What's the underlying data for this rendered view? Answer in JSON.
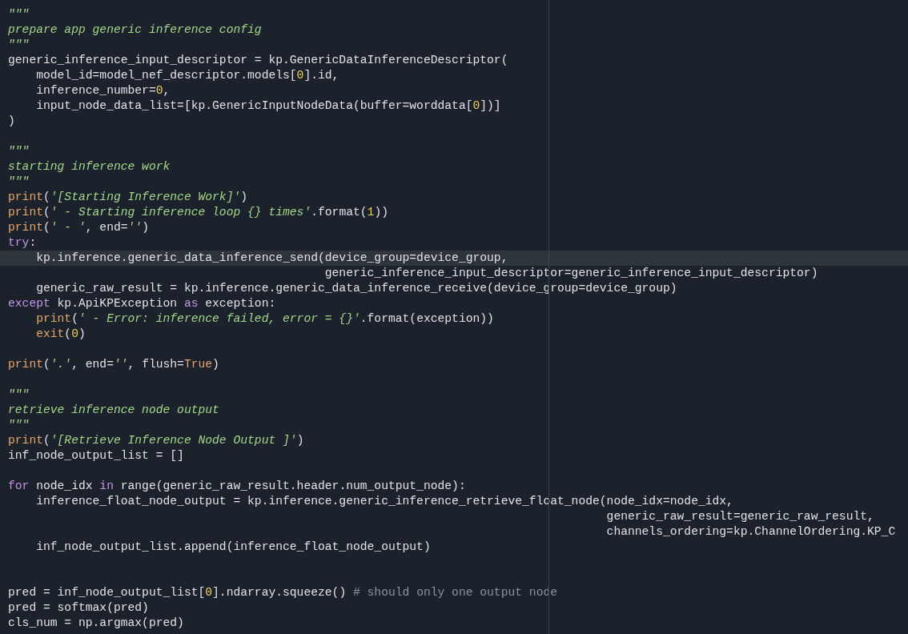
{
  "editor": {
    "lines": [
      {
        "selected": false,
        "tokens": [
          {
            "kind": "str",
            "text": "\"\"\""
          }
        ]
      },
      {
        "selected": false,
        "tokens": [
          {
            "kind": "str",
            "text": "prepare app generic inference config"
          }
        ]
      },
      {
        "selected": false,
        "tokens": [
          {
            "kind": "str",
            "text": "\"\"\""
          }
        ]
      },
      {
        "selected": false,
        "tokens": [
          {
            "kind": "plain",
            "text": "generic_inference_input_descriptor = kp.GenericDataInferenceDescriptor("
          }
        ]
      },
      {
        "selected": false,
        "tokens": [
          {
            "kind": "plain",
            "text": "    model_id=model_nef_descriptor.models["
          },
          {
            "kind": "num",
            "text": "0"
          },
          {
            "kind": "plain",
            "text": "].id,"
          }
        ]
      },
      {
        "selected": false,
        "tokens": [
          {
            "kind": "plain",
            "text": "    inference_number="
          },
          {
            "kind": "num",
            "text": "0"
          },
          {
            "kind": "plain",
            "text": ","
          }
        ]
      },
      {
        "selected": false,
        "tokens": [
          {
            "kind": "plain",
            "text": "    input_node_data_list=[kp.GenericInputNodeData(buffer=worddata["
          },
          {
            "kind": "num",
            "text": "0"
          },
          {
            "kind": "plain",
            "text": "])]"
          }
        ]
      },
      {
        "selected": false,
        "tokens": [
          {
            "kind": "plain",
            "text": ")"
          }
        ]
      },
      {
        "selected": false
      },
      {
        "selected": false,
        "tokens": [
          {
            "kind": "str",
            "text": "\"\"\""
          }
        ]
      },
      {
        "selected": false,
        "tokens": [
          {
            "kind": "str",
            "text": "starting inference work"
          }
        ]
      },
      {
        "selected": false,
        "tokens": [
          {
            "kind": "str",
            "text": "\"\"\""
          }
        ]
      },
      {
        "selected": false,
        "tokens": [
          {
            "kind": "fn",
            "text": "print"
          },
          {
            "kind": "plain",
            "text": "("
          },
          {
            "kind": "str",
            "text": "'[Starting Inference Work]'"
          },
          {
            "kind": "plain",
            "text": ")"
          }
        ]
      },
      {
        "selected": false,
        "tokens": [
          {
            "kind": "fn",
            "text": "print"
          },
          {
            "kind": "plain",
            "text": "("
          },
          {
            "kind": "str",
            "text": "' - Starting inference loop {} times'"
          },
          {
            "kind": "plain",
            "text": ".format("
          },
          {
            "kind": "num",
            "text": "1"
          },
          {
            "kind": "plain",
            "text": "))"
          }
        ]
      },
      {
        "selected": false,
        "tokens": [
          {
            "kind": "fn",
            "text": "print"
          },
          {
            "kind": "plain",
            "text": "("
          },
          {
            "kind": "str",
            "text": "' - '"
          },
          {
            "kind": "plain",
            "text": ", end="
          },
          {
            "kind": "str",
            "text": "''"
          },
          {
            "kind": "plain",
            "text": ")"
          }
        ]
      },
      {
        "selected": false,
        "tokens": [
          {
            "kind": "kw",
            "text": "try"
          },
          {
            "kind": "plain",
            "text": ":"
          }
        ]
      },
      {
        "selected": true,
        "tokens": [
          {
            "kind": "plain",
            "text": "    kp.inference.generic_data_inference_send(device_group=device_group,"
          }
        ]
      },
      {
        "selected": false,
        "tokens": [
          {
            "kind": "plain",
            "text": "                                             generic_inference_input_descriptor=generic_inference_input_descriptor)"
          }
        ]
      },
      {
        "selected": false,
        "tokens": [
          {
            "kind": "plain",
            "text": "    generic_raw_result = kp.inference.generic_data_inference_receive(device_group=device_group)"
          }
        ]
      },
      {
        "selected": false,
        "tokens": [
          {
            "kind": "kw",
            "text": "except"
          },
          {
            "kind": "plain",
            "text": " kp.ApiKPException "
          },
          {
            "kind": "kw",
            "text": "as"
          },
          {
            "kind": "plain",
            "text": " exception:"
          }
        ]
      },
      {
        "selected": false,
        "indented": true,
        "tokens": [
          {
            "kind": "fn",
            "text": "print"
          },
          {
            "kind": "plain",
            "text": "("
          },
          {
            "kind": "str",
            "text": "' - Error: inference failed, error = {}'"
          },
          {
            "kind": "plain",
            "text": ".format(exception))"
          }
        ]
      },
      {
        "selected": false,
        "indented": true,
        "tokens": [
          {
            "kind": "fn",
            "text": "exit"
          },
          {
            "kind": "plain",
            "text": "("
          },
          {
            "kind": "num",
            "text": "0"
          },
          {
            "kind": "plain",
            "text": ")"
          }
        ]
      },
      {
        "selected": false
      },
      {
        "selected": false,
        "tokens": [
          {
            "kind": "fn",
            "text": "print"
          },
          {
            "kind": "plain",
            "text": "("
          },
          {
            "kind": "str",
            "text": "'.'"
          },
          {
            "kind": "plain",
            "text": ", end="
          },
          {
            "kind": "str",
            "text": "''"
          },
          {
            "kind": "plain",
            "text": ", flush="
          },
          {
            "kind": "const",
            "text": "True"
          },
          {
            "kind": "plain",
            "text": ")"
          }
        ]
      },
      {
        "selected": false
      },
      {
        "selected": false,
        "tokens": [
          {
            "kind": "str",
            "text": "\"\"\""
          }
        ]
      },
      {
        "selected": false,
        "tokens": [
          {
            "kind": "str",
            "text": "retrieve inference node output"
          }
        ]
      },
      {
        "selected": false,
        "tokens": [
          {
            "kind": "str",
            "text": "\"\"\""
          }
        ]
      },
      {
        "selected": false,
        "tokens": [
          {
            "kind": "fn",
            "text": "print"
          },
          {
            "kind": "plain",
            "text": "("
          },
          {
            "kind": "str",
            "text": "'[Retrieve Inference Node Output ]'"
          },
          {
            "kind": "plain",
            "text": ")"
          }
        ]
      },
      {
        "selected": false,
        "tokens": [
          {
            "kind": "plain",
            "text": "inf_node_output_list = []"
          }
        ]
      },
      {
        "selected": false
      },
      {
        "selected": false,
        "tokens": [
          {
            "kind": "kw",
            "text": "for"
          },
          {
            "kind": "plain",
            "text": " node_idx "
          },
          {
            "kind": "kw",
            "text": "in"
          },
          {
            "kind": "plain",
            "text": " range(generic_raw_result.header.num_output_node):"
          }
        ]
      },
      {
        "selected": false,
        "tokens": [
          {
            "kind": "plain",
            "text": "    inference_float_node_output = kp.inference.generic_inference_retrieve_float_node(node_idx=node_idx,"
          }
        ]
      },
      {
        "selected": false,
        "tokens": [
          {
            "kind": "plain",
            "text": "                                                                                     generic_raw_result=generic_raw_result,"
          }
        ]
      },
      {
        "selected": false,
        "tokens": [
          {
            "kind": "plain",
            "text": "                                                                                     channels_ordering=kp.ChannelOrdering.KP_C"
          }
        ]
      },
      {
        "selected": false,
        "tokens": [
          {
            "kind": "plain",
            "text": "    inf_node_output_list.append(inference_float_node_output)"
          }
        ]
      },
      {
        "selected": false
      },
      {
        "selected": false
      },
      {
        "selected": false,
        "tokens": [
          {
            "kind": "plain",
            "text": "pred = inf_node_output_list["
          },
          {
            "kind": "num",
            "text": "0"
          },
          {
            "kind": "plain",
            "text": "].ndarray.squeeze() "
          },
          {
            "kind": "comment",
            "text": "# should only one output node"
          }
        ]
      },
      {
        "selected": false,
        "tokens": [
          {
            "kind": "plain",
            "text": "pred = softmax(pred)"
          }
        ]
      },
      {
        "selected": false,
        "tokens": [
          {
            "kind": "plain",
            "text": "cls_num = np.argmax(pred)"
          }
        ]
      }
    ]
  }
}
